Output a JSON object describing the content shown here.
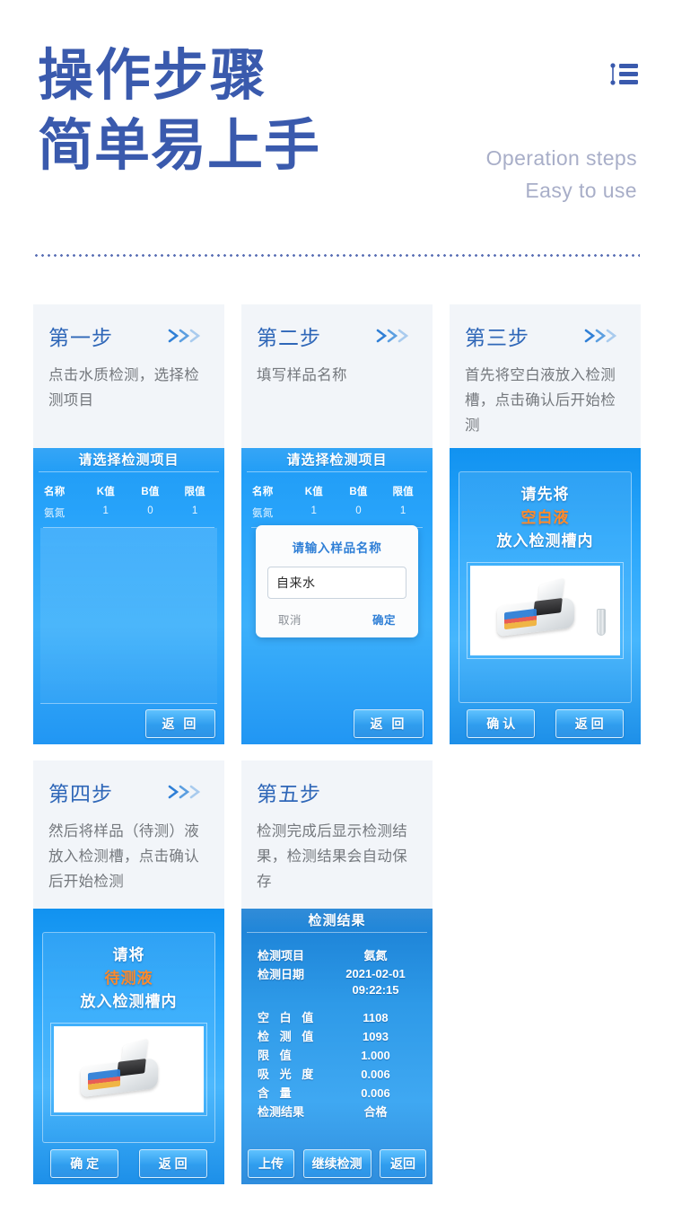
{
  "header": {
    "title_line1": "操作步骤",
    "title_line2": "简单易上手",
    "subtitle_line1": "Operation steps",
    "subtitle_line2": "Easy to use",
    "icon": "list-icon",
    "title_color": "#3a5aad",
    "subtitle_color": "#a8aec8"
  },
  "steps": [
    {
      "step_label": "第一步",
      "has_arrows": true,
      "description": "点击水质检测，选择检测项目"
    },
    {
      "step_label": "第二步",
      "has_arrows": true,
      "description": "填写样品名称"
    },
    {
      "step_label": "第三步",
      "has_arrows": true,
      "description": "首先将空白液放入检测槽，点击确认后开始检测"
    },
    {
      "step_label": "第四步",
      "has_arrows": true,
      "description": "然后将样品（待测）液放入检测槽，点击确认后开始检测"
    },
    {
      "step_label": "第五步",
      "has_arrows": false,
      "description": "检测完成后显示检测结果，检测结果会自动保存"
    }
  ],
  "screen_list": {
    "title": "请选择检测项目",
    "columns": [
      "名称",
      "K值",
      "B值",
      "限值"
    ],
    "rows": [
      [
        "氨氮",
        "1",
        "0",
        "1"
      ]
    ],
    "back_button": "返 回"
  },
  "screen_dialog": {
    "title": "请选择检测项目",
    "columns": [
      "名称",
      "K值",
      "B值",
      "限值"
    ],
    "rows": [
      [
        "氨氮",
        "1",
        "0",
        "1"
      ]
    ],
    "dialog_title": "请输入样品名称",
    "input_value": "自来水",
    "cancel_button": "取消",
    "confirm_button": "确定",
    "back_button": "返 回"
  },
  "screen_blank": {
    "prompt_line1": "请先将",
    "prompt_highlight": "空白液",
    "prompt_line3": "放入检测槽内",
    "highlight_color": "#ff8a2b",
    "confirm_button": "确 认",
    "back_button": "返 回"
  },
  "screen_sample": {
    "prompt_line1": "请将",
    "prompt_highlight": "待测液",
    "prompt_line3": "放入检测槽内",
    "highlight_color": "#ff8a2b",
    "confirm_button": "确 定",
    "back_button": "返 回"
  },
  "screen_result": {
    "title": "检测结果",
    "fields": [
      {
        "key": "检测项目",
        "value": "氨氮"
      },
      {
        "key": "检测日期",
        "value": "2021-02-01",
        "value2": "09:22:15"
      },
      {
        "key": "空 白 值",
        "value": "1108"
      },
      {
        "key": "检 测 值",
        "value": "1093"
      },
      {
        "key": "限    值",
        "value": "1.000"
      },
      {
        "key": "吸 光 度",
        "value": "0.006"
      },
      {
        "key": "含    量",
        "value": "0.006"
      },
      {
        "key": "检测结果",
        "value": "合格"
      }
    ],
    "upload_button": "上传",
    "continue_button": "继续检测",
    "back_button": "返回"
  }
}
